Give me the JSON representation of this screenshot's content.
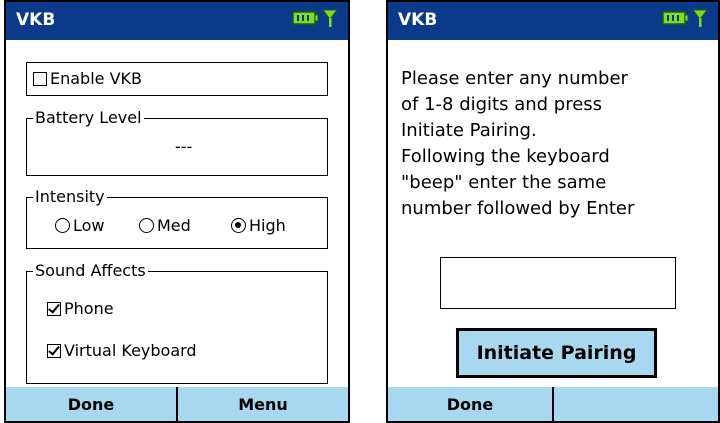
{
  "left_screen": {
    "title": "VKB",
    "enable_vkb": {
      "label": "Enable VKB",
      "checked": false
    },
    "battery_level": {
      "legend": "Battery Level",
      "value": "---"
    },
    "intensity": {
      "legend": "Intensity",
      "options": [
        {
          "label": "Low",
          "selected": false
        },
        {
          "label": "Med",
          "selected": false
        },
        {
          "label": "High",
          "selected": true
        }
      ]
    },
    "sound_affects": {
      "legend": "Sound Affects",
      "items": [
        {
          "label": "Phone",
          "checked": true
        },
        {
          "label": "Virtual Keyboard",
          "checked": true
        }
      ]
    },
    "softkeys": {
      "left": "Done",
      "right": "Menu"
    }
  },
  "right_screen": {
    "title": "VKB",
    "instructions": [
      "Please enter any number",
      "of 1-8 digits and press",
      "Initiate Pairing.",
      "Following the keyboard",
      "\"beep\" enter the same",
      "number followed by Enter"
    ],
    "pairing_input_value": "",
    "button_label": "Initiate Pairing",
    "softkeys": {
      "left": "Done",
      "right": ""
    }
  },
  "colors": {
    "title_bar": "#0b3a8a",
    "softkey_bar": "#a8d8f0",
    "battery_icon": "#7ddc2a"
  },
  "icons": [
    "battery-icon",
    "signal-icon"
  ]
}
